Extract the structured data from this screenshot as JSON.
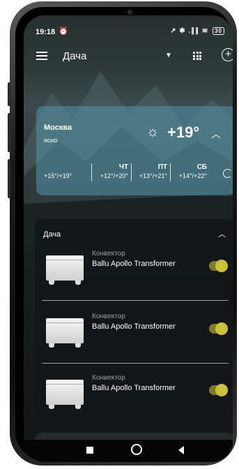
{
  "status": {
    "time": "19:18",
    "alarm_icon": "alarm-icon",
    "icons": "↗ ✱ .∥∥ ≋",
    "battery": "30"
  },
  "topbar": {
    "title": "Дача",
    "grid_icon": "grid-icon",
    "add_icon": "add-icon"
  },
  "weather": {
    "city": "Москва",
    "condition": "ясно",
    "temperature": "+19°",
    "today_range": "+15°/+19°",
    "forecast": [
      {
        "day": "ЧТ",
        "range": "+12°/+20°"
      },
      {
        "day": "ПТ",
        "range": "+13°/+21°"
      },
      {
        "day": "СБ",
        "range": "+14°/+22°"
      }
    ]
  },
  "group": {
    "title": "Дача",
    "devices": [
      {
        "type": "Конвектор",
        "name": "Ballu Apollo Transformer",
        "on": true
      },
      {
        "type": "Конвектор",
        "name": "Ballu Apollo Transformer",
        "on": true
      },
      {
        "type": "Конвектор",
        "name": "Ballu Apollo Transformer",
        "on": true
      }
    ]
  },
  "colors": {
    "accent": "#c9c23a",
    "weather_card": "#5496aa"
  }
}
